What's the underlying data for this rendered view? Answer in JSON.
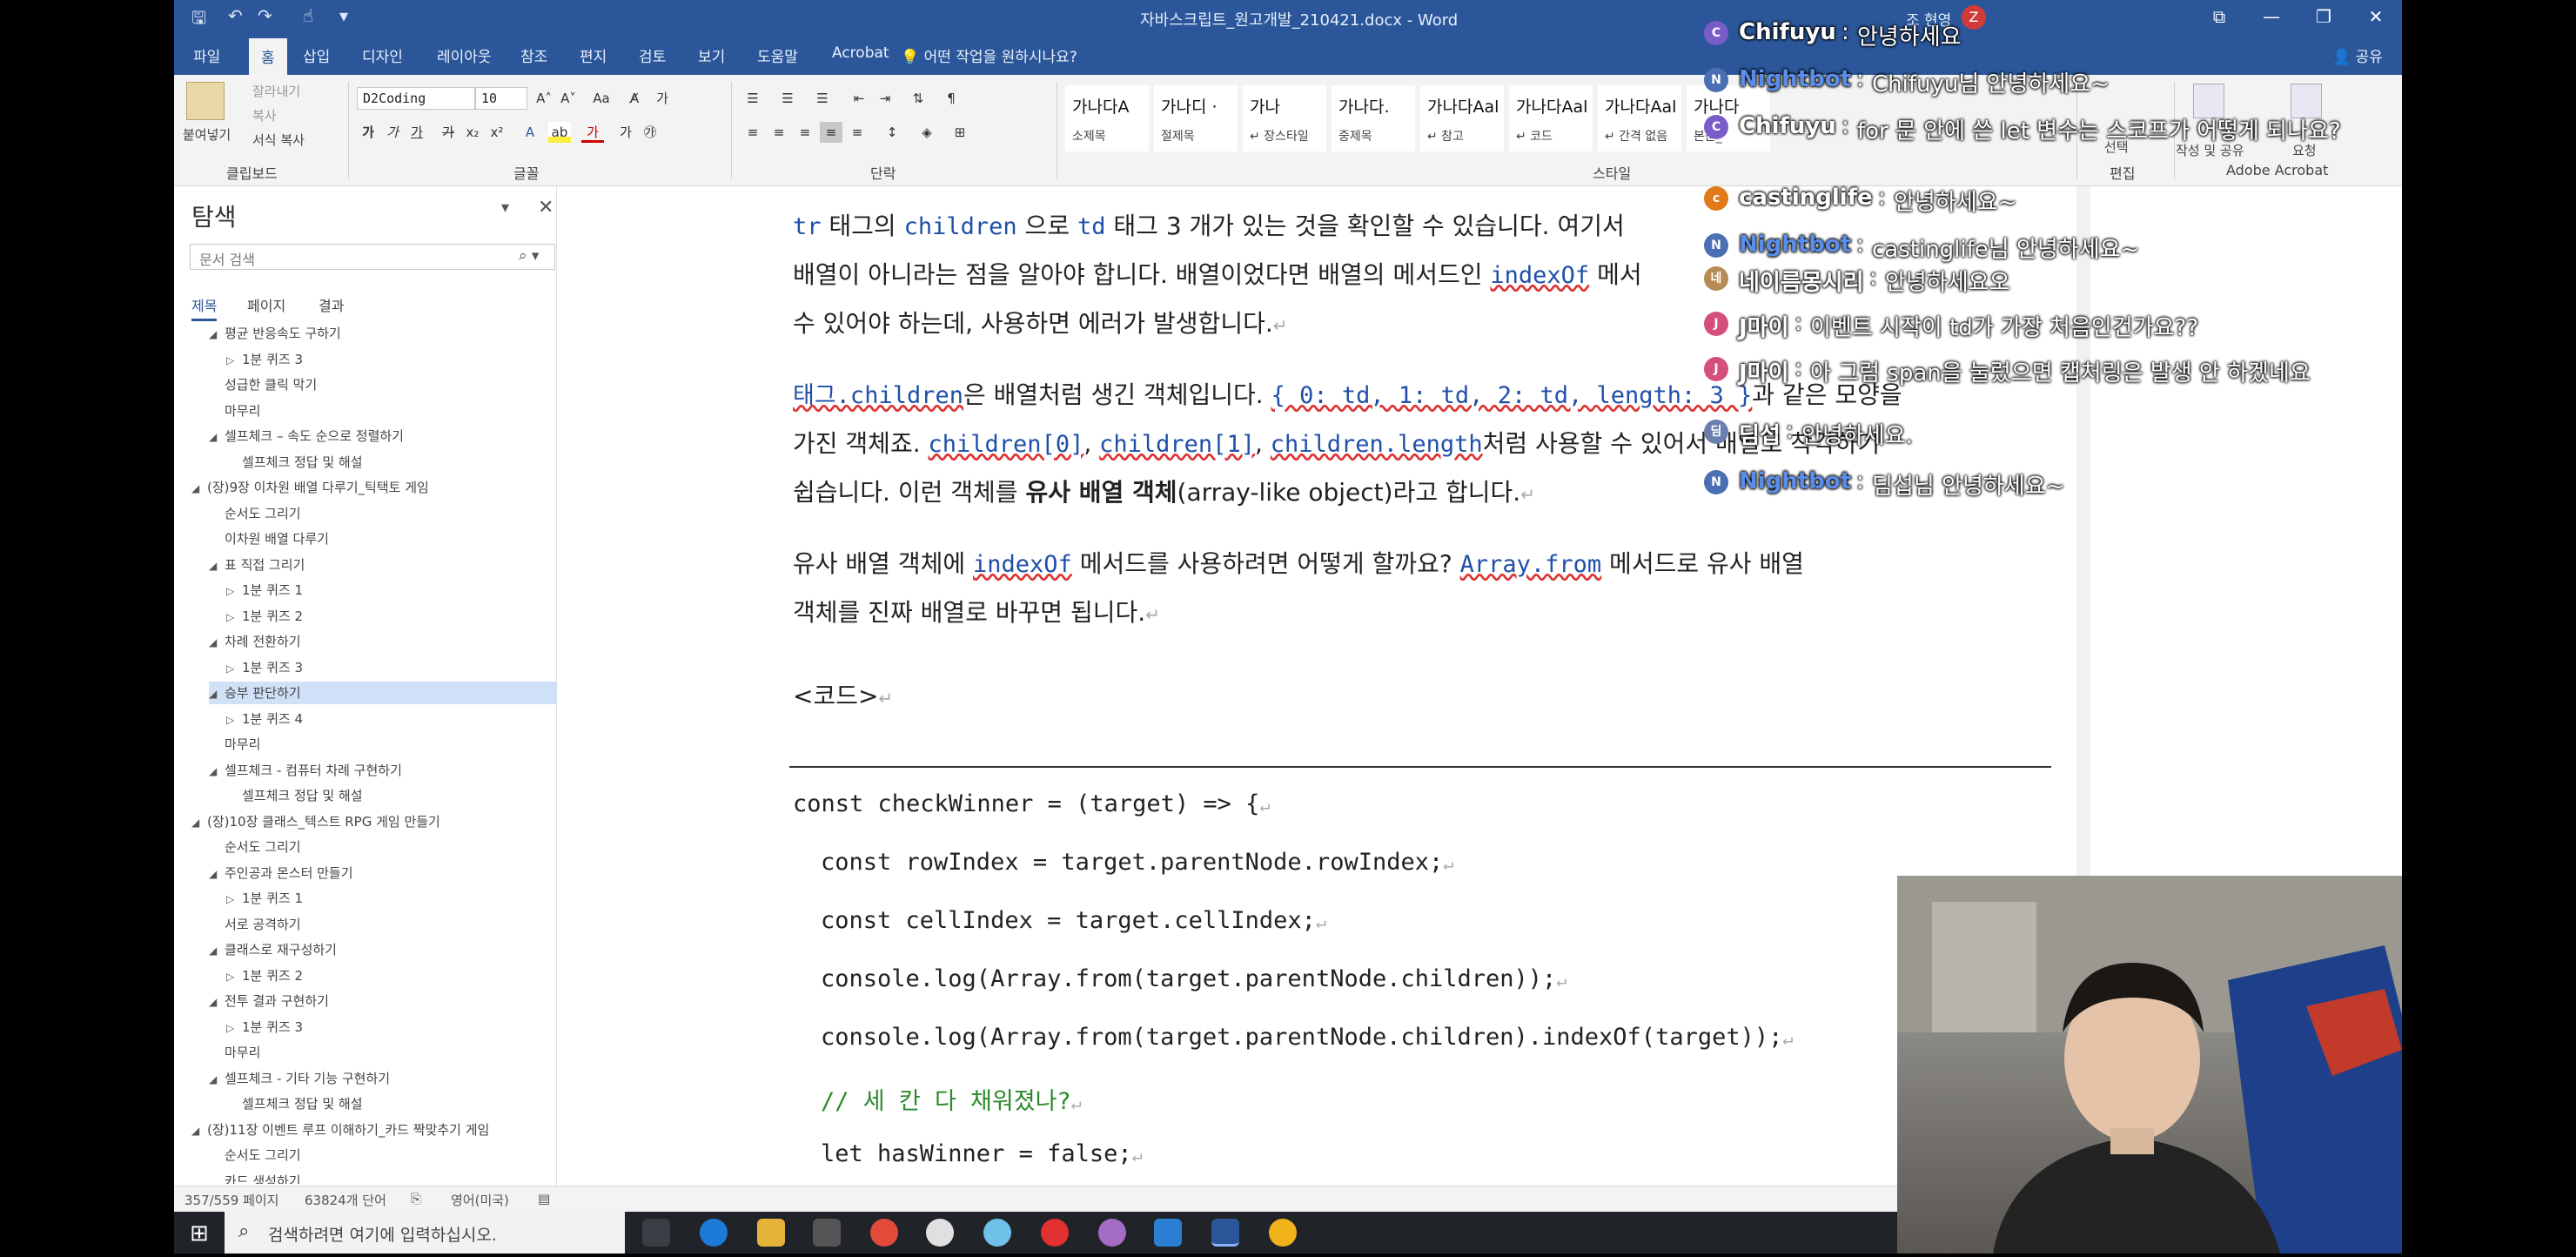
{
  "window": {
    "title": "자바스크립트_원고개발_210421.docx - Word",
    "user_name": "조 현영",
    "user_initial": "Z",
    "controls": [
      "⧉",
      "—",
      "❐",
      "✕"
    ]
  },
  "menu": {
    "tabs": [
      "파일",
      "홈",
      "삽입",
      "디자인",
      "레이아웃",
      "참조",
      "편지",
      "검토",
      "보기",
      "도움말",
      "Acrobat"
    ],
    "active_tab": "홈",
    "tell_me": "어떤 작업을 원하시나요?",
    "share": "공유"
  },
  "ribbon": {
    "clipboard": {
      "label": "클립보드",
      "paste": "붙여넣기",
      "cut": "잘라내기",
      "copy": "복사",
      "format_painter": "서식 복사"
    },
    "font": {
      "label": "글꼴",
      "font_name": "D2Coding",
      "font_size": "10"
    },
    "paragraph": {
      "label": "단락"
    },
    "styles": {
      "label": "스타일",
      "tiles": [
        {
          "preview": "가나다A",
          "name": "소제목"
        },
        {
          "preview": "가나디 ·",
          "name": "절제목"
        },
        {
          "preview": "가나",
          "name": "↵ 장스타일"
        },
        {
          "preview": "가나다.",
          "name": "중제목"
        },
        {
          "preview": "가나다Aal",
          "name": "↵ 참고"
        },
        {
          "preview": "가나다Aal",
          "name": "↵ 코드"
        },
        {
          "preview": "가나다Aal",
          "name": "↵ 간격 없음"
        },
        {
          "preview": "가나다",
          "name": "본문_"
        }
      ]
    },
    "editing": {
      "label": "편집",
      "select": "선택"
    },
    "acrobat": {
      "label": "Adobe Acrobat",
      "create_share": "작성 및 공유",
      "request": "요청"
    }
  },
  "nav": {
    "title": "탐색",
    "search_placeholder": "문서 검색",
    "tabs": [
      "제목",
      "페이지",
      "결과"
    ],
    "items": [
      {
        "level": 2,
        "arrow": "◢",
        "text": "평균 반응속도 구하기"
      },
      {
        "level": 3,
        "arrow": "▷",
        "text": "1분 퀴즈 3"
      },
      {
        "level": 2,
        "arrow": "",
        "text": "성급한 클릭 막기"
      },
      {
        "level": 2,
        "arrow": "",
        "text": "마무리"
      },
      {
        "level": 2,
        "arrow": "◢",
        "text": "셀프체크 – 속도 순으로 정렬하기"
      },
      {
        "level": 3,
        "arrow": "",
        "text": "셀프체크 정답 및 해설"
      },
      {
        "level": 1,
        "arrow": "◢",
        "text": "(장)9장 이차원 배열 다루기_틱택토 게임"
      },
      {
        "level": 2,
        "arrow": "",
        "text": "순서도 그리기"
      },
      {
        "level": 2,
        "arrow": "",
        "text": "이차원 배열 다루기"
      },
      {
        "level": 2,
        "arrow": "◢",
        "text": "표 직접 그리기"
      },
      {
        "level": 3,
        "arrow": "▷",
        "text": "1분 퀴즈 1"
      },
      {
        "level": 3,
        "arrow": "▷",
        "text": "1분 퀴즈 2"
      },
      {
        "level": 2,
        "arrow": "◢",
        "text": "차례 전환하기"
      },
      {
        "level": 3,
        "arrow": "▷",
        "text": "1분 퀴즈 3"
      },
      {
        "level": 2,
        "arrow": "◢",
        "text": "승부 판단하기",
        "selected": true
      },
      {
        "level": 3,
        "arrow": "▷",
        "text": "1분 퀴즈 4"
      },
      {
        "level": 2,
        "arrow": "",
        "text": "마무리"
      },
      {
        "level": 2,
        "arrow": "◢",
        "text": "셀프체크 - 컴퓨터 차례 구현하기"
      },
      {
        "level": 3,
        "arrow": "",
        "text": "셀프체크 정답 및 해설"
      },
      {
        "level": 1,
        "arrow": "◢",
        "text": "(장)10장 클래스_텍스트 RPG 게임 만들기"
      },
      {
        "level": 2,
        "arrow": "",
        "text": "순서도 그리기"
      },
      {
        "level": 2,
        "arrow": "◢",
        "text": "주인공과 몬스터 만들기"
      },
      {
        "level": 3,
        "arrow": "▷",
        "text": "1분 퀴즈 1"
      },
      {
        "level": 2,
        "arrow": "",
        "text": "서로 공격하기"
      },
      {
        "level": 2,
        "arrow": "◢",
        "text": "클래스로 재구성하기"
      },
      {
        "level": 3,
        "arrow": "▷",
        "text": "1분 퀴즈 2"
      },
      {
        "level": 2,
        "arrow": "◢",
        "text": "전투 결과 구현하기"
      },
      {
        "level": 3,
        "arrow": "▷",
        "text": "1분 퀴즈 3"
      },
      {
        "level": 2,
        "arrow": "",
        "text": "마무리"
      },
      {
        "level": 2,
        "arrow": "◢",
        "text": "셀프체크 - 기타 기능 구현하기"
      },
      {
        "level": 3,
        "arrow": "",
        "text": "셀프체크 정답 및 해설"
      },
      {
        "level": 1,
        "arrow": "◢",
        "text": "(장)11장 이벤트 루프 이해하기_카드 짝맞추기 게임"
      },
      {
        "level": 2,
        "arrow": "",
        "text": "순서도 그리기"
      },
      {
        "level": 2,
        "arrow": "",
        "text": "카드 생성하기"
      }
    ]
  },
  "doc": {
    "p1_l1": [
      "tr",
      " 태그의 ",
      "children",
      " 으로 ",
      "td",
      " 태그 3 개가 있는 것을 확인할 수 있습니다. 여기서"
    ],
    "p1_l2": [
      "배열이 아니라는 점을 알아야 합니다. 배열이었다면 배열의 메서드인 ",
      "indexOf",
      " 메서"
    ],
    "p1_l3": "수 있어야 하는데, 사용하면 에러가 발생합니다.",
    "p2_l1": [
      "태그.children",
      "은 배열처럼 생긴 객체입니다. ",
      "{ 0: td, 1: td, 2: td, length: 3 }",
      "과 같은 모양을"
    ],
    "p2_l2": [
      "가진 객체죠. ",
      "children[0]",
      ", ",
      "children[1]",
      ", ",
      "children.length",
      "처럼 사용할 수 있어서 배열로 착각하기"
    ],
    "p2_l3": [
      "쉽습니다. 이런 객체를 ",
      "유사 배열 객체",
      "(array-like object)라고 합니다."
    ],
    "p3_l1": [
      "유사 배열 객체에 ",
      "indexOf",
      " 메서드를 사용하려면 어떻게 할까요? ",
      "Array.from",
      " 메서드로 유사 배열"
    ],
    "p3_l2": "객체를 진짜 배열로 바꾸면 됩니다.",
    "code_heading": "<코드>",
    "code_lines": [
      "const checkWinner = (target) => {",
      "  const rowIndex = target.parentNode.rowIndex;",
      "  const cellIndex = target.cellIndex;",
      "  console.log(Array.from(target.parentNode.children));",
      "  console.log(Array.from(target.parentNode.children).indexOf(target));",
      "  // 세 칸 다 채워졌나?",
      "  let hasWinner = false;"
    ],
    "para_mark": "↵"
  },
  "status": {
    "page": "357/559 페이지",
    "words": "63824개 단어",
    "lang": "영어(미국)"
  },
  "taskbar": {
    "search": "검색하려면 여기에 입력하십시오."
  },
  "chat": [
    {
      "avatar": "C",
      "avatar_color": "#7a5cc9",
      "name": "Chifuyu",
      "name_color": "#ffffff",
      "msg": "안녕하세요"
    },
    {
      "avatar": "N",
      "avatar_color": "#4a6fb5",
      "name": "Nightbot",
      "name_color": "#5a8de8",
      "msg": "Chifuyu님 안녕하세요~"
    },
    {
      "avatar": "C",
      "avatar_color": "#7a5cc9",
      "name": "Chifuyu",
      "name_color": "#ffffff",
      "msg": "for 문 안에 쓴 let 변수는 스코프가 어떻게 되나요?"
    },
    {
      "avatar": "c",
      "avatar_color": "#e07a1a",
      "name": "castinglife",
      "name_color": "#ffffff",
      "msg": "안녕하세요~"
    },
    {
      "avatar": "N",
      "avatar_color": "#4a6fb5",
      "name": "Nightbot",
      "name_color": "#5a8de8",
      "msg": "castinglife님 안녕하세요~"
    },
    {
      "avatar": "네",
      "avatar_color": "#b88a55",
      "name": "네이름몽시리",
      "name_color": "#ffffff",
      "msg": "안녕하세요오"
    },
    {
      "avatar": "J",
      "avatar_color": "#d44f7a",
      "name": "J마이",
      "name_color": "#ffffff",
      "msg": "이벤트 시작이 td가 가장 처음인건가요??"
    },
    {
      "avatar": "J",
      "avatar_color": "#d44f7a",
      "name": "J마이",
      "name_color": "#ffffff",
      "msg": "아 그럼 span을 눌렀으면 캡처링은 발생 안 하겠네요"
    },
    {
      "avatar": "딤",
      "avatar_color": "#6a7fae",
      "name": "딤섭",
      "name_color": "#ffffff",
      "msg": "안녕하세요."
    },
    {
      "avatar": "N",
      "avatar_color": "#4a6fb5",
      "name": "Nightbot",
      "name_color": "#5a8de8",
      "msg": "딤섭님 안녕하세요~"
    }
  ],
  "colors": {
    "word_blue": "#2b579a",
    "code_keyword": "#1f4fa8",
    "comment_green": "#2c8a2c",
    "spell_underline": "#d33333"
  }
}
